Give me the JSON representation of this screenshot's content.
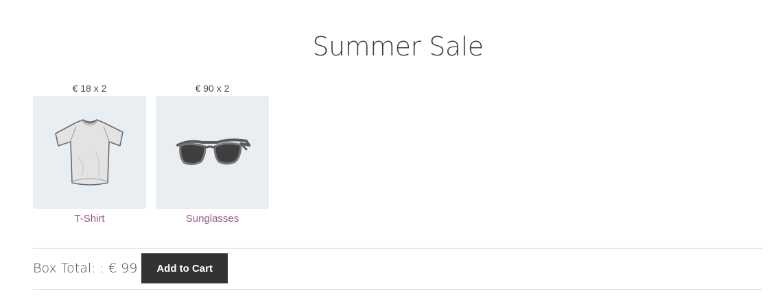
{
  "page": {
    "title": "Summer Sale"
  },
  "products": [
    {
      "price_label": "€ 18 x 2",
      "name": "T-Shirt",
      "icon": "tshirt-icon"
    },
    {
      "price_label": "€ 90 x 2",
      "name": "Sunglasses",
      "icon": "sunglasses-icon"
    }
  ],
  "summary": {
    "total_label": "Box Total: : € 99",
    "add_to_cart_label": "Add to Cart"
  },
  "colors": {
    "link": "#96588a",
    "button_bg": "#333333",
    "tile_bg": "#e9eef2"
  }
}
